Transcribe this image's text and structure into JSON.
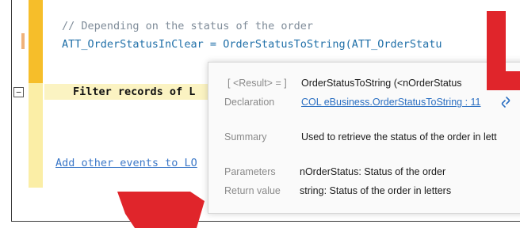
{
  "editor": {
    "comment_line": "// Depending on the status of the order",
    "assign_line": "ATT_OrderStatusInClear = OrderStatusToString(ATT_OrderStatu",
    "filter_line": "Filter records of L",
    "add_events_link": "Add other events to LO"
  },
  "tooltip": {
    "result_label": "[ <Result> = ]",
    "signature": "OrderStatusToString (<nOrderStatus",
    "declaration_label": "Declaration",
    "declaration_link": "COL eBusiness.OrderStatusToString : 11",
    "summary_label": "Summary",
    "summary_text": "Used to retrieve the status of the order in lett",
    "parameters_label": "Parameters",
    "parameters_text": "nOrderStatus: Status of the order",
    "return_label": "Return value",
    "return_text": "string: Status of the order in letters"
  },
  "colors": {
    "gutter_orange": "#f6be2a",
    "gutter_yellow": "#fbeea6",
    "accent_red": "#e0252b",
    "link_blue": "#2b6fc2"
  },
  "icons": {
    "collapse": "minus-box-icon",
    "link": "chain-link-icon",
    "annotation_top": "red-arrow-annotation",
    "annotation_bottom": "red-arrow-annotation"
  }
}
